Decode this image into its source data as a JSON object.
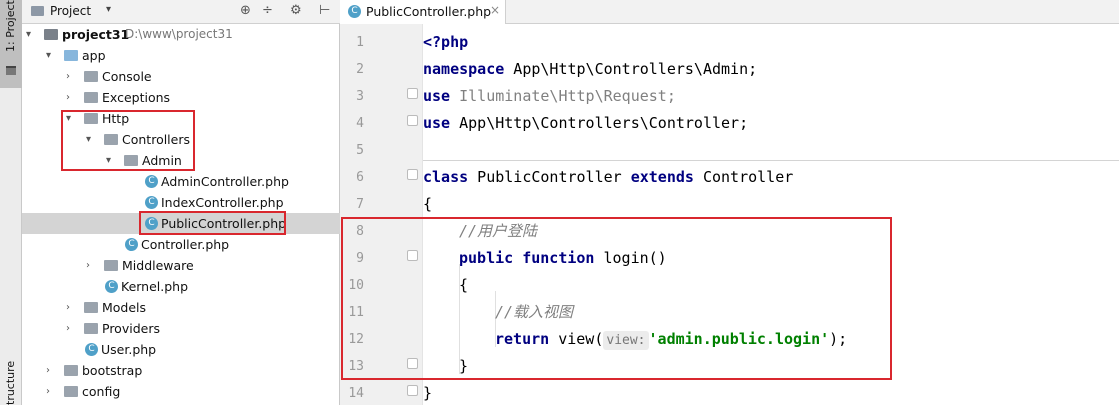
{
  "left_strip": {
    "project_tab": "1: Project",
    "structure_tab": "tructure"
  },
  "project_panel": {
    "title": "Project",
    "dropdown": "▾",
    "tools": [
      "⊕",
      "÷",
      "⚙",
      "⊢"
    ],
    "tree": [
      {
        "label": "project31",
        "path": "D:\\www\\project31",
        "bold": true,
        "arrow": "▾",
        "icon": "folder-dark"
      },
      {
        "label": "app",
        "arrow": "▾",
        "icon": "folder-blue"
      },
      {
        "label": "Console",
        "arrow": "›",
        "icon": "folder"
      },
      {
        "label": "Exceptions",
        "arrow": "›",
        "icon": "folder"
      },
      {
        "label": "Http",
        "arrow": "▾",
        "icon": "folder"
      },
      {
        "label": "Controllers",
        "arrow": "▾",
        "icon": "folder"
      },
      {
        "label": "Admin",
        "arrow": "▾",
        "icon": "folder"
      },
      {
        "label": "AdminController.php",
        "icon": "php-class"
      },
      {
        "label": "IndexController.php",
        "icon": "php-class"
      },
      {
        "label": "PublicController.php",
        "icon": "php-class",
        "selected": true
      },
      {
        "label": "Controller.php",
        "icon": "php-class"
      },
      {
        "label": "Middleware",
        "arrow": "›",
        "icon": "folder"
      },
      {
        "label": "Kernel.php",
        "icon": "php-class"
      },
      {
        "label": "Models",
        "arrow": "›",
        "icon": "folder"
      },
      {
        "label": "Providers",
        "arrow": "›",
        "icon": "folder"
      },
      {
        "label": "User.php",
        "icon": "php-class"
      },
      {
        "label": "bootstrap",
        "arrow": "›",
        "icon": "folder"
      },
      {
        "label": "config",
        "arrow": "›",
        "icon": "folder"
      }
    ]
  },
  "editor": {
    "tab": {
      "label": "PublicController.php",
      "icon_letter": "C",
      "close": "×"
    },
    "line_numbers": [
      "1",
      "2",
      "3",
      "4",
      "5",
      "6",
      "7",
      "8",
      "9",
      "10",
      "11",
      "12",
      "13",
      "14"
    ],
    "lines": {
      "l1": {
        "a": "<?php"
      },
      "l2": {
        "kw": "namespace",
        "rest": " App\\Http\\Controllers\\Admin;"
      },
      "l3": {
        "kw": "use",
        "rest": " Illuminate\\Http\\Request;"
      },
      "l4": {
        "kw": "use",
        "rest": " App\\Http\\Controllers\\Controller;"
      },
      "l6": {
        "kw1": "class",
        "mid": " PublicController ",
        "kw2": "extends",
        "rest": " Controller"
      },
      "l7": {
        "a": "{"
      },
      "l8": {
        "comment": "//用户登陆"
      },
      "l9": {
        "kw1": "public",
        "sp": " ",
        "kw2": "function",
        "rest": " login()"
      },
      "l10": {
        "a": "{"
      },
      "l11": {
        "comment": "//载入视图"
      },
      "l12": {
        "kw": "return",
        "mid": " view(",
        "hint": "view:",
        "str": "'admin.public.login'",
        "end": ");"
      },
      "l13": {
        "a": "}"
      },
      "l14": {
        "a": "}"
      }
    }
  },
  "colors": {
    "highlight_box": "#d9272e",
    "keyword": "#000080",
    "string": "#008000",
    "comment": "#808080"
  }
}
